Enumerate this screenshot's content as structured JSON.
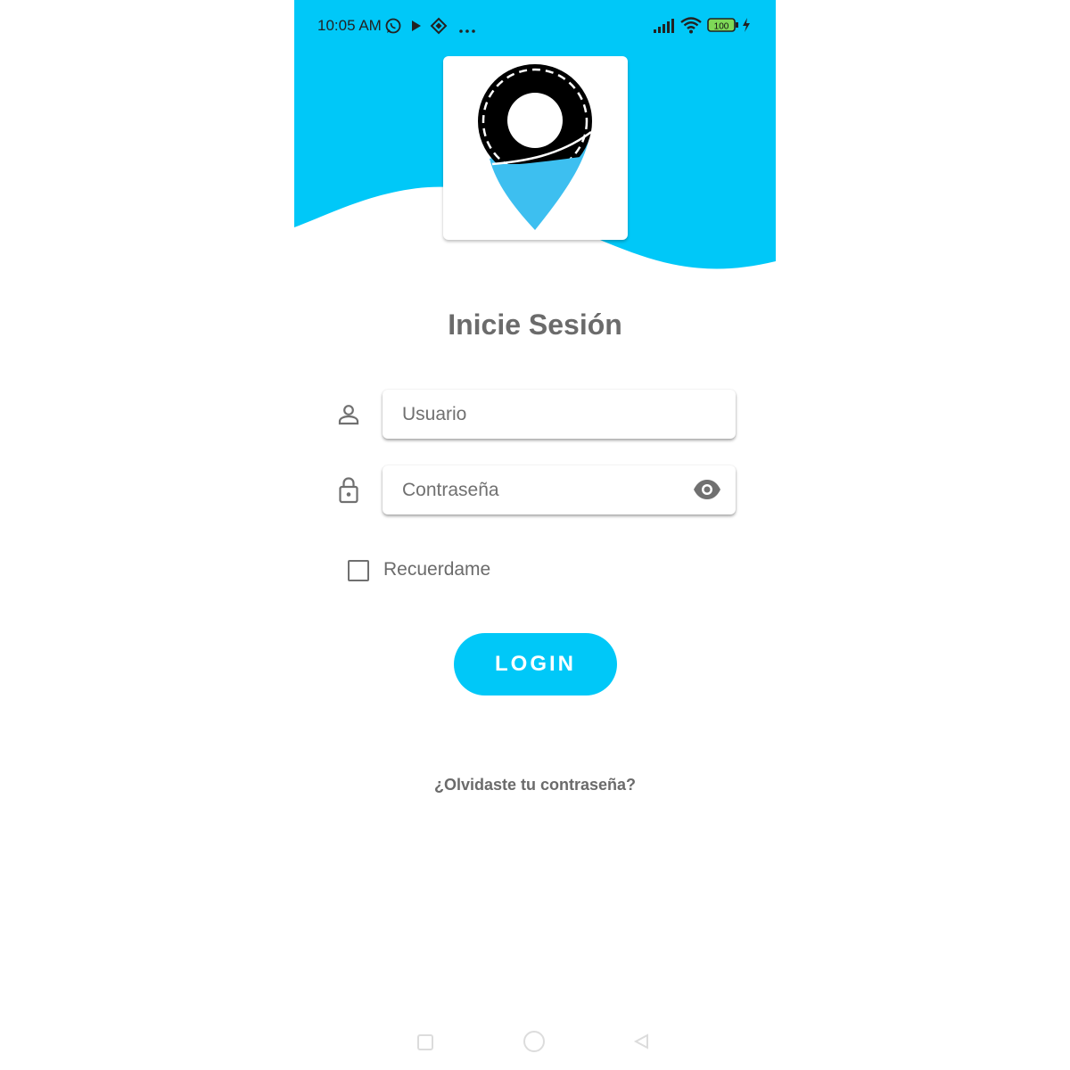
{
  "status_bar": {
    "time": "10:05 AM",
    "battery": "100",
    "icons": [
      "whatsapp-icon",
      "play-icon",
      "binance-icon",
      "more-icon",
      "signal-icon",
      "wifi-icon",
      "battery-icon",
      "charging-icon"
    ]
  },
  "brand": {
    "accent": "#00c8f8",
    "pin_blue": "#3dbff0"
  },
  "login": {
    "title": "Inicie Sesión",
    "username_placeholder": "Usuario",
    "password_placeholder": "Contraseña",
    "remember_label": "Recuerdame",
    "login_button": "LOGIN",
    "forgot_link": "¿Olvidaste tu contraseña?"
  },
  "nav": {
    "icons": [
      "recents-icon",
      "home-icon",
      "back-icon"
    ]
  }
}
